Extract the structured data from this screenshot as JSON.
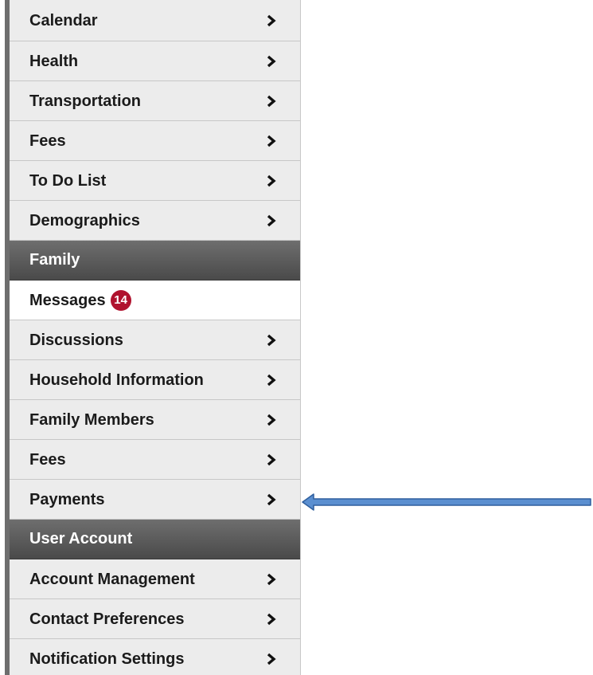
{
  "menu": {
    "student_items": [
      {
        "label": "Calendar"
      },
      {
        "label": "Health"
      },
      {
        "label": "Transportation"
      },
      {
        "label": "Fees"
      },
      {
        "label": "To Do List"
      },
      {
        "label": "Demographics"
      }
    ],
    "family_section": {
      "title": "Family",
      "messages": {
        "label": "Messages",
        "badge_count": "14"
      },
      "items": [
        {
          "label": "Discussions"
        },
        {
          "label": "Household Information"
        },
        {
          "label": "Family Members"
        },
        {
          "label": "Fees"
        },
        {
          "label": "Payments"
        }
      ]
    },
    "user_account_section": {
      "title": "User Account",
      "items": [
        {
          "label": "Account Management"
        },
        {
          "label": "Contact Preferences"
        },
        {
          "label": "Notification Settings"
        }
      ]
    }
  },
  "icons": {
    "chevron": "chevron-right-icon",
    "annotation_arrow": "left-arrow-icon"
  },
  "colors": {
    "item_bg": "#ececec",
    "section_bg": "#555555",
    "badge_bg": "#b0122e",
    "arrow_fill": "#5b8fd0",
    "arrow_stroke": "#2f5f9e"
  }
}
